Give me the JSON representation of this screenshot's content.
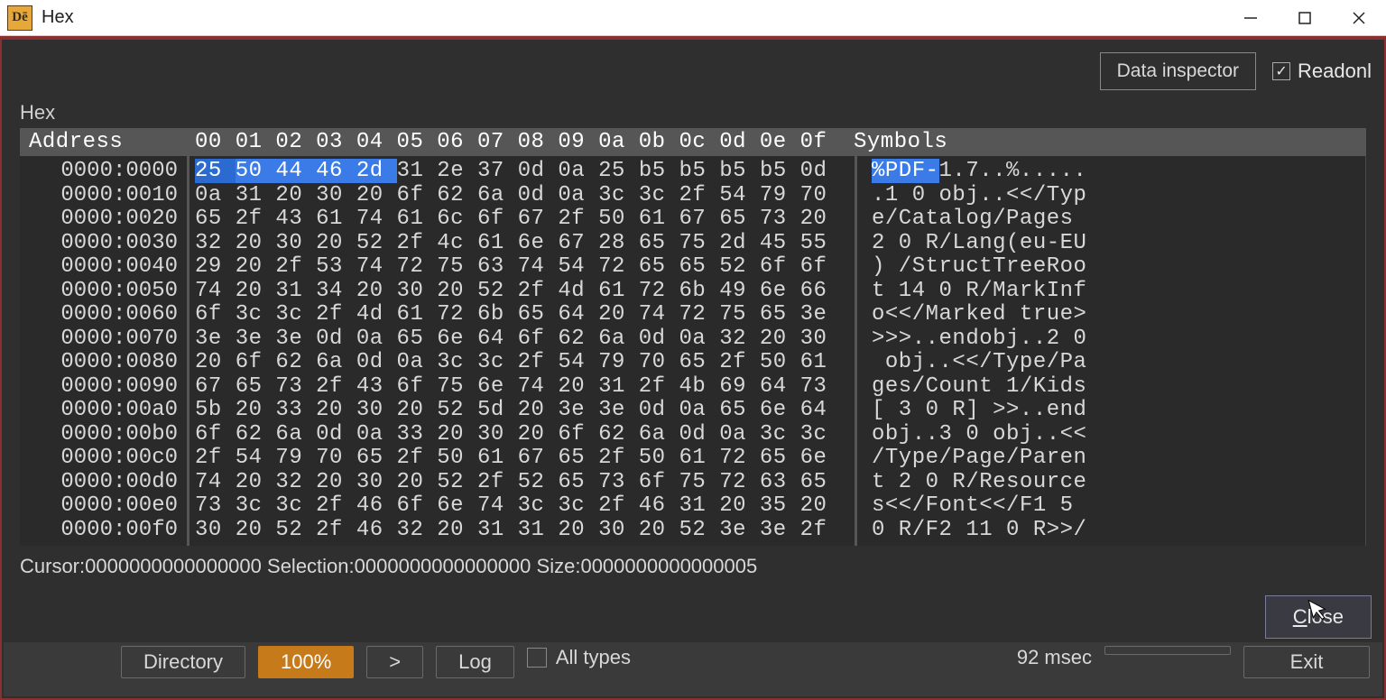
{
  "window": {
    "app_icon_text": "Dē",
    "title": "Hex"
  },
  "toolbar": {
    "data_inspector_label": "Data inspector",
    "readonly_label": "Readonl"
  },
  "panel_label": "Hex",
  "header": {
    "address": "Address",
    "hex": "00 01 02 03 04 05 06 07 08 09 0a 0b 0c 0d 0e 0f",
    "symbols": "Symbols"
  },
  "rows": [
    {
      "addr": "0000:0000",
      "hex": [
        "25",
        "50",
        "44",
        "46",
        "2d",
        "31",
        "2e",
        "37",
        "0d",
        "0a",
        "25",
        "b5",
        "b5",
        "b5",
        "b5",
        "0d"
      ],
      "sym": "%PDF-1.7..%....."
    },
    {
      "addr": "0000:0010",
      "hex": [
        "0a",
        "31",
        "20",
        "30",
        "20",
        "6f",
        "62",
        "6a",
        "0d",
        "0a",
        "3c",
        "3c",
        "2f",
        "54",
        "79",
        "70"
      ],
      "sym": ".1 0 obj..<</Typ"
    },
    {
      "addr": "0000:0020",
      "hex": [
        "65",
        "2f",
        "43",
        "61",
        "74",
        "61",
        "6c",
        "6f",
        "67",
        "2f",
        "50",
        "61",
        "67",
        "65",
        "73",
        "20"
      ],
      "sym": "e/Catalog/Pages "
    },
    {
      "addr": "0000:0030",
      "hex": [
        "32",
        "20",
        "30",
        "20",
        "52",
        "2f",
        "4c",
        "61",
        "6e",
        "67",
        "28",
        "65",
        "75",
        "2d",
        "45",
        "55"
      ],
      "sym": "2 0 R/Lang(eu-EU"
    },
    {
      "addr": "0000:0040",
      "hex": [
        "29",
        "20",
        "2f",
        "53",
        "74",
        "72",
        "75",
        "63",
        "74",
        "54",
        "72",
        "65",
        "65",
        "52",
        "6f",
        "6f"
      ],
      "sym": ") /StructTreeRoo"
    },
    {
      "addr": "0000:0050",
      "hex": [
        "74",
        "20",
        "31",
        "34",
        "20",
        "30",
        "20",
        "52",
        "2f",
        "4d",
        "61",
        "72",
        "6b",
        "49",
        "6e",
        "66"
      ],
      "sym": "t 14 0 R/MarkInf"
    },
    {
      "addr": "0000:0060",
      "hex": [
        "6f",
        "3c",
        "3c",
        "2f",
        "4d",
        "61",
        "72",
        "6b",
        "65",
        "64",
        "20",
        "74",
        "72",
        "75",
        "65",
        "3e"
      ],
      "sym": "o<</Marked true>"
    },
    {
      "addr": "0000:0070",
      "hex": [
        "3e",
        "3e",
        "3e",
        "0d",
        "0a",
        "65",
        "6e",
        "64",
        "6f",
        "62",
        "6a",
        "0d",
        "0a",
        "32",
        "20",
        "30"
      ],
      "sym": ">>>..endobj..2 0"
    },
    {
      "addr": "0000:0080",
      "hex": [
        "20",
        "6f",
        "62",
        "6a",
        "0d",
        "0a",
        "3c",
        "3c",
        "2f",
        "54",
        "79",
        "70",
        "65",
        "2f",
        "50",
        "61"
      ],
      "sym": " obj..<</Type/Pa"
    },
    {
      "addr": "0000:0090",
      "hex": [
        "67",
        "65",
        "73",
        "2f",
        "43",
        "6f",
        "75",
        "6e",
        "74",
        "20",
        "31",
        "2f",
        "4b",
        "69",
        "64",
        "73"
      ],
      "sym": "ges/Count 1/Kids"
    },
    {
      "addr": "0000:00a0",
      "hex": [
        "5b",
        "20",
        "33",
        "20",
        "30",
        "20",
        "52",
        "5d",
        "20",
        "3e",
        "3e",
        "0d",
        "0a",
        "65",
        "6e",
        "64"
      ],
      "sym": "[ 3 0 R] >>..end"
    },
    {
      "addr": "0000:00b0",
      "hex": [
        "6f",
        "62",
        "6a",
        "0d",
        "0a",
        "33",
        "20",
        "30",
        "20",
        "6f",
        "62",
        "6a",
        "0d",
        "0a",
        "3c",
        "3c"
      ],
      "sym": "obj..3 0 obj..<<"
    },
    {
      "addr": "0000:00c0",
      "hex": [
        "2f",
        "54",
        "79",
        "70",
        "65",
        "2f",
        "50",
        "61",
        "67",
        "65",
        "2f",
        "50",
        "61",
        "72",
        "65",
        "6e"
      ],
      "sym": "/Type/Page/Paren"
    },
    {
      "addr": "0000:00d0",
      "hex": [
        "74",
        "20",
        "32",
        "20",
        "30",
        "20",
        "52",
        "2f",
        "52",
        "65",
        "73",
        "6f",
        "75",
        "72",
        "63",
        "65"
      ],
      "sym": "t 2 0 R/Resource"
    },
    {
      "addr": "0000:00e0",
      "hex": [
        "73",
        "3c",
        "3c",
        "2f",
        "46",
        "6f",
        "6e",
        "74",
        "3c",
        "3c",
        "2f",
        "46",
        "31",
        "20",
        "35",
        "20"
      ],
      "sym": "s<</Font<</F1 5 "
    },
    {
      "addr": "0000:00f0",
      "hex": [
        "30",
        "20",
        "52",
        "2f",
        "46",
        "32",
        "20",
        "31",
        "31",
        "20",
        "30",
        "20",
        "52",
        "3e",
        "3e",
        "2f"
      ],
      "sym": "0 R/F2 11 0 R>>/"
    }
  ],
  "selection": {
    "row": 0,
    "caret": 0,
    "start": 0,
    "end": 4,
    "sym_len": 5
  },
  "status": {
    "cursor_label": "Cursor:",
    "cursor_value": "0000000000000000",
    "selection_label": "Selection:",
    "selection_value": "0000000000000000",
    "size_label": "Size:",
    "size_value": "0000000000000005"
  },
  "close_label": "Close",
  "bg": {
    "directory": "Directory",
    "percent": "100%",
    "next": ">",
    "log": "Log",
    "alltypes": "All types",
    "msec": "92 msec",
    "exit": "Exit"
  }
}
